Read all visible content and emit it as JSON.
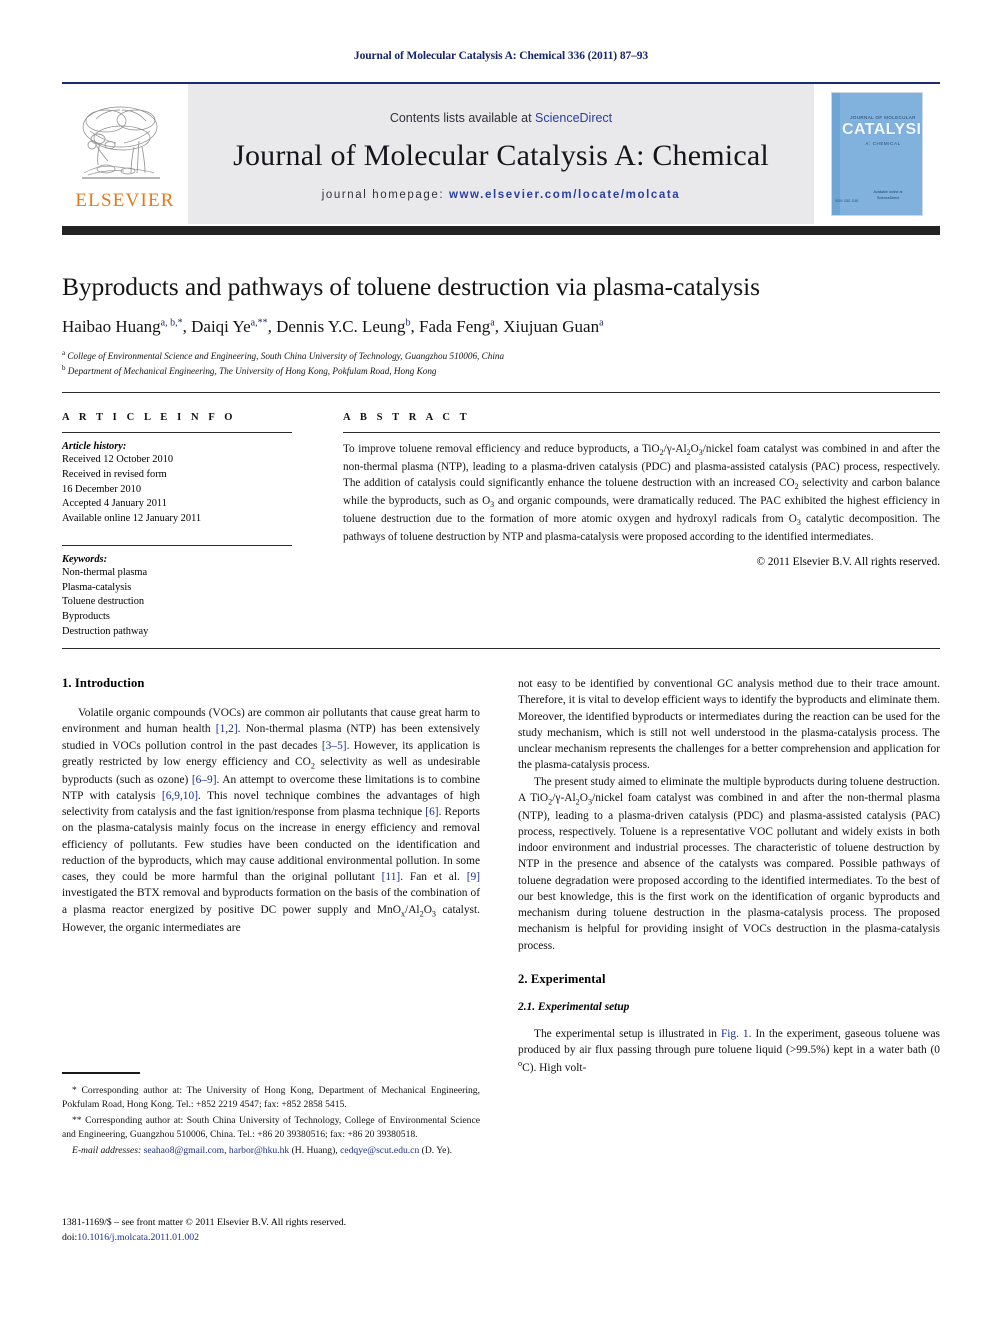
{
  "running_head": "Journal of Molecular Catalysis A: Chemical 336 (2011) 87–93",
  "masthead": {
    "publisher": "ELSEVIER",
    "contents_prefix": "Contents lists available at ",
    "contents_link": "ScienceDirect",
    "journal_title": "Journal of Molecular Catalysis A: Chemical",
    "homepage_label": "journal homepage:",
    "homepage_url": "www.elsevier.com/locate/molcata",
    "cover": {
      "super_title": "JOURNAL OF MOLECULAR",
      "main_title": "CATALYSIS",
      "sub_title": "A: CHEMICAL",
      "bottom_note": "Available online at\nScienceDirect",
      "corner_note": "ISSN 1381-1169"
    }
  },
  "article": {
    "title": "Byproducts and pathways of toluene destruction via plasma-catalysis",
    "authors_html": "Haibao Huang<sup>a, b,</sup><sup>*</sup>, Daiqi Ye<sup>a,</sup><sup>**</sup>, Dennis Y.C. Leung<sup>b</sup>, Fada Feng<sup>a</sup>, Xiujuan Guan<sup>a</sup>",
    "affiliation_a": "College of Environmental Science and Engineering, South China University of Technology, Guangzhou 510006, China",
    "affiliation_b": "Department of Mechanical Engineering, The University of Hong Kong, Pokfulam Road, Hong Kong"
  },
  "info": {
    "heading": "A R T I C L E    I N F O",
    "history_label": "Article history:",
    "history": [
      "Received 12 October 2010",
      "Received in revised form",
      "16 December 2010",
      "Accepted 4 January 2011",
      "Available online 12 January 2011"
    ],
    "keywords_label": "Keywords:",
    "keywords": [
      "Non-thermal plasma",
      "Plasma-catalysis",
      "Toluene destruction",
      "Byproducts",
      "Destruction pathway"
    ]
  },
  "abstract": {
    "heading": "A B S T R A C T",
    "text_html": "To improve toluene removal efficiency and reduce byproducts, a TiO<sub>2</sub>/&gamma;-Al<sub>2</sub>O<sub>3</sub>/nickel foam catalyst was combined in and after the non-thermal plasma (NTP), leading to a plasma-driven catalysis (PDC) and plasma-assisted catalysis (PAC) process, respectively. The addition of catalysis could significantly enhance the toluene destruction with an increased CO<sub>2</sub> selectivity and carbon balance while the byproducts, such as O<sub>3</sub> and organic compounds, were dramatically reduced. The PAC exhibited the highest efficiency in toluene destruction due to the formation of more atomic oxygen and hydroxyl radicals from O<sub>3</sub> catalytic decomposition. The pathways of toluene destruction by NTP and plasma-catalysis were proposed according to the identified intermediates.",
    "rights": "© 2011 Elsevier B.V. All rights reserved."
  },
  "sections": {
    "intro_heading": "1.  Introduction",
    "intro_p1_html": "Volatile organic compounds (VOCs) are common air pollutants that cause great harm to environment and human health <span class=\"ref\">[1,2]</span>. Non-thermal plasma (NTP) has been extensively studied in VOCs pollution control in the past decades <span class=\"ref\">[3–5]</span>. However, its application is greatly restricted by low energy efficiency and CO<sub>2</sub> selectivity as well as undesirable byproducts (such as ozone) <span class=\"ref\">[6–9]</span>. An attempt to overcome these limitations is to combine NTP with catalysis <span class=\"ref\">[6,9,10]</span>. This novel technique combines the advantages of high selectivity from catalysis and the fast ignition/response from plasma technique <span class=\"ref\">[6]</span>. Reports on the plasma-catalysis mainly focus on the increase in energy efficiency and removal efficiency of pollutants. Few studies have been conducted on the identification and reduction of the byproducts, which may cause additional environmental pollution. In some cases, they could be more harmful than the original pollutant <span class=\"ref\">[11]</span>. Fan et al. <span class=\"ref\">[9]</span> investigated the BTX removal and byproducts formation on the basis of the combination of a plasma reactor energized by positive DC power supply and MnO<sub>x</sub>/Al<sub>2</sub>O<sub>3</sub> catalyst. However, the organic intermediates are not easy to be identified by conventional GC analysis method due to their trace amount. Therefore, it is vital to develop efficient ways to identify the byproducts and eliminate them. Moreover, the identified byproducts or intermediates during the reaction can be used for the study mechanism, which is still not well understood in the plasma-catalysis process. The unclear mechanism represents the challenges for a better comprehension and application for the plasma-catalysis process.",
    "intro_p2_html": "The present study aimed to eliminate the multiple byproducts during toluene destruction. A TiO<sub>2</sub>/&gamma;-Al<sub>2</sub>O<sub>3</sub>/nickel foam catalyst was combined in and after the non-thermal plasma (NTP), leading to a plasma-driven catalysis (PDC) and plasma-assisted catalysis (PAC) process, respectively. Toluene is a representative VOC pollutant and widely exists in both indoor environment and industrial processes. The characteristic of toluene destruction by NTP in the presence and absence of the catalysts was compared. Possible pathways of toluene degradation were proposed according to the identified intermediates. To the best of our best knowledge, this is the first work on the identification of organic byproducts and mechanism during toluene destruction in the plasma-catalysis process. The proposed mechanism is helpful for providing insight of VOCs destruction in the plasma-catalysis process.",
    "exp_heading": "2.  Experimental",
    "exp_sub_heading": "2.1.  Experimental setup",
    "exp_p1_html": "The experimental setup is illustrated in <span class=\"ref\">Fig. 1</span>. In the experiment, gaseous toluene was produced by air flux passing through pure toluene liquid (&gt;99.5%) kept in a water bath (0 <sup class=\"inl\">o</sup>C). High volt-"
  },
  "footnotes": {
    "corr1": "*  Corresponding author at: The University of Hong Kong, Department of Mechanical Engineering, Pokfulam Road, Hong Kong. Tel.: +852 2219 4547; fax: +852 2858 5415.",
    "corr2": "**  Corresponding author at: South China University of Technology, College of Environmental Science and Engineering, Guangzhou 510006, China. Tel.: +86 20 39380516; fax: +86 20 39380518.",
    "email_label": "E-mail addresses:",
    "email1": "seahao8@gmail.com",
    "email2": "harbor@hku.hk",
    "email1_owner": "(H. Huang),",
    "email3": "cedqye@scut.edu.cn",
    "email3_owner": "(D. Ye)."
  },
  "issn": {
    "line1": "1381-1169/$ – see front matter © 2011 Elsevier B.V. All rights reserved.",
    "doi_prefix": "doi:",
    "doi": "10.1016/j.molcata.2011.01.002"
  },
  "colors": {
    "link": "#1b2f8c",
    "elsevier_orange": "#e77817",
    "masthead_band": "#e9e9ec",
    "rule_dark": "#232323",
    "cover_blue": "#81b2dd"
  }
}
